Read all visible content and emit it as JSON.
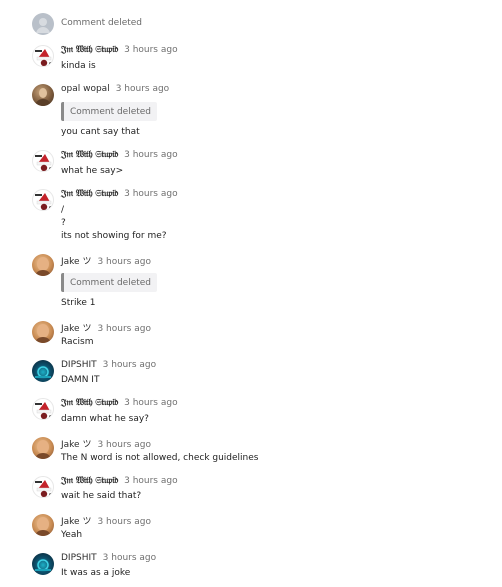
{
  "messages": [
    {
      "type": "deleted",
      "text": "Comment deleted"
    },
    {
      "author": "𝔍𝔪 𝔚𝔦𝔱𝔥 𝔖𝔱𝔲𝔭𝔦𝔡",
      "time": "3 hours ago",
      "lines": [
        "kinda is"
      ]
    },
    {
      "author": "opal wopal",
      "time": "3 hours ago",
      "quote": "Comment deleted",
      "lines": [
        "you cant say that"
      ]
    },
    {
      "author": "𝔍𝔪 𝔚𝔦𝔱𝔥 𝔖𝔱𝔲𝔭𝔦𝔡",
      "time": "3 hours ago",
      "lines": [
        "what he say>"
      ]
    },
    {
      "author": "𝔍𝔪 𝔚𝔦𝔱𝔥 𝔖𝔱𝔲𝔭𝔦𝔡",
      "time": "3 hours ago",
      "lines": [
        "/",
        "?",
        "its not showing for me?"
      ]
    },
    {
      "author": "Jake ツ",
      "time": "3 hours ago",
      "quote": "Comment deleted",
      "lines": [
        "Strike 1"
      ]
    },
    {
      "author": "Jake ツ",
      "time": "3 hours ago",
      "lines": [
        "Racism"
      ]
    },
    {
      "author": "DIPSHIT",
      "time": "3 hours ago",
      "lines": [
        "DAMN IT"
      ]
    },
    {
      "author": "𝔍𝔪 𝔚𝔦𝔱𝔥 𝔖𝔱𝔲𝔭𝔦𝔡",
      "time": "3 hours ago",
      "lines": [
        "damn what he say?"
      ]
    },
    {
      "author": "Jake ツ",
      "time": "3 hours ago",
      "lines": [
        "The N word is not allowed, check guidelines"
      ]
    },
    {
      "author": "𝔍𝔪 𝔚𝔦𝔱𝔥 𝔖𝔱𝔲𝔭𝔦𝔡",
      "time": "3 hours ago",
      "lines": [
        "wait he said that?"
      ]
    },
    {
      "author": "Jake ツ",
      "time": "3 hours ago",
      "lines": [
        "Yeah"
      ]
    },
    {
      "author": "DIPSHIT",
      "time": "3 hours ago",
      "lines": [
        "It was as a joke"
      ]
    }
  ],
  "avatars": {
    "deleted": "deleted-user-avatar",
    "santa": "santa-hat-avatar",
    "opal": "opal-photo-avatar",
    "jake": "bald-man-avatar",
    "dip": "blue-glow-avatar"
  },
  "colors": {
    "quote_border": "#8a8a8a",
    "quote_bg": "#f2f2f4",
    "time": "#707070"
  }
}
